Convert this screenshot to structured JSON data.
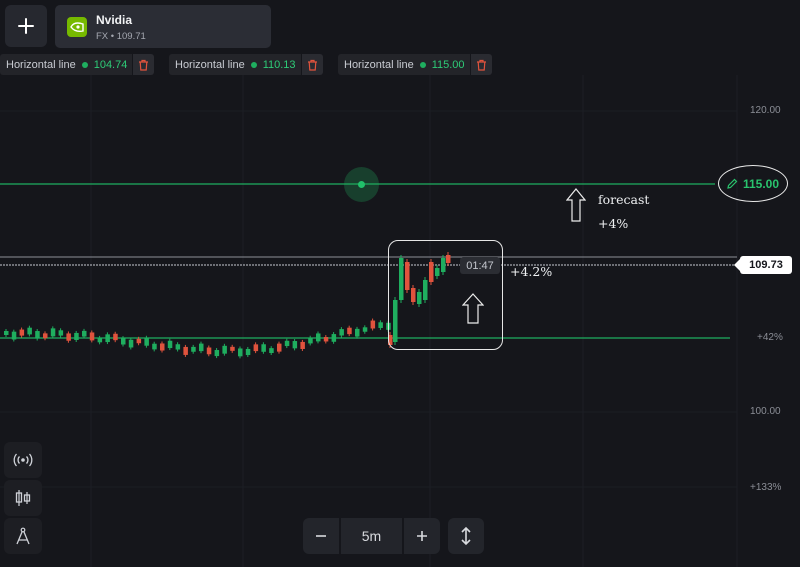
{
  "header": {
    "add_button_icon": "plus-icon",
    "asset": {
      "name": "Nvidia",
      "subtitle": "FX • 109.71",
      "logo_icon": "nvidia-logo-icon",
      "logo_color": "#76b900"
    }
  },
  "horizontal_lines": [
    {
      "label": "Horizontal line",
      "value": "104.74",
      "delete_icon": "trash-icon"
    },
    {
      "label": "Horizontal line",
      "value": "110.13",
      "delete_icon": "trash-icon"
    },
    {
      "label": "Horizontal line",
      "value": "115.00",
      "delete_icon": "trash-icon"
    }
  ],
  "price_axis": {
    "labels": [
      {
        "text": "120.00"
      },
      {
        "text": "+42%"
      },
      {
        "text": "100.00"
      },
      {
        "text": "+133%"
      }
    ]
  },
  "forecast_line": {
    "value": "115.00",
    "edit_icon": "pencil-icon",
    "color": "#1fae5f"
  },
  "current_price": {
    "value": "109.73",
    "timer": "01:47"
  },
  "annotations": {
    "forecast_label": "forecast",
    "forecast_pct": "+4%",
    "box_pct": "+4.2%"
  },
  "side_tools": [
    {
      "icon": "signal-broadcast-icon"
    },
    {
      "icon": "candlestick-icon"
    },
    {
      "icon": "drawing-compass-icon"
    }
  ],
  "timeframe": {
    "minus_icon": "minus-icon",
    "value": "5m",
    "plus_icon": "plus-icon",
    "resize_icon": "vertical-arrows-icon"
  },
  "colors": {
    "background": "#15161b",
    "bull": "#1fae5f",
    "bear": "#e0533d",
    "accent_green": "#2ecb77"
  }
}
